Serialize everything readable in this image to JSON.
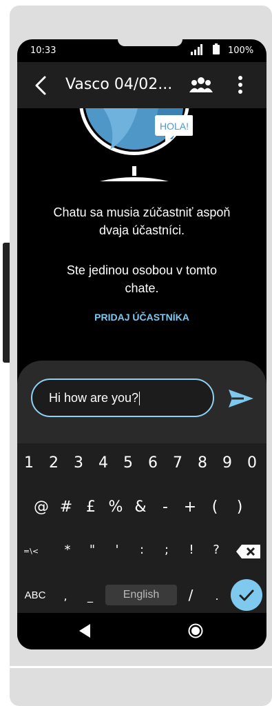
{
  "status": {
    "time": "10:33",
    "battery": "100%",
    "icons": [
      "signal-icon",
      "battery-icon"
    ]
  },
  "appbar": {
    "title": "Vasco 04/02...",
    "icons": [
      "back-arrow-icon",
      "group-icon",
      "more-vert-icon"
    ]
  },
  "illustration": {
    "badge": "HOLA!"
  },
  "empty_state": {
    "line1": "Chatu sa musia zúčastniť aspoň",
    "line2": "dvaja účastníci.",
    "line3": "Ste jedinou osobou v tomto",
    "line4": "chate.",
    "action": "PRIDAJ ÚČASTNÍKA"
  },
  "composer": {
    "value": "Hi how are you?",
    "send_icon": "send-icon"
  },
  "keyboard": {
    "row1": [
      "1",
      "2",
      "3",
      "4",
      "5",
      "6",
      "7",
      "8",
      "9",
      "0"
    ],
    "row2": [
      "@",
      "#",
      "£",
      "%",
      "&",
      "-",
      "+",
      "(",
      ")"
    ],
    "row3": [
      "=\\<",
      "*",
      "\"",
      "'",
      ":",
      ";",
      "!",
      "?"
    ],
    "row4": {
      "abc": "ABC",
      "comma": ",",
      "underscore": "_",
      "language": "English",
      "slash": "/",
      "period": "."
    },
    "icons": [
      "backspace-icon",
      "checkmark-icon"
    ]
  },
  "navbar": {
    "icons": [
      "nav-back-icon",
      "nav-home-icon"
    ]
  },
  "colors": {
    "accent": "#7fc8ee",
    "appbar": "#1f1f1f",
    "background": "#000000",
    "frame": "#dedede"
  }
}
